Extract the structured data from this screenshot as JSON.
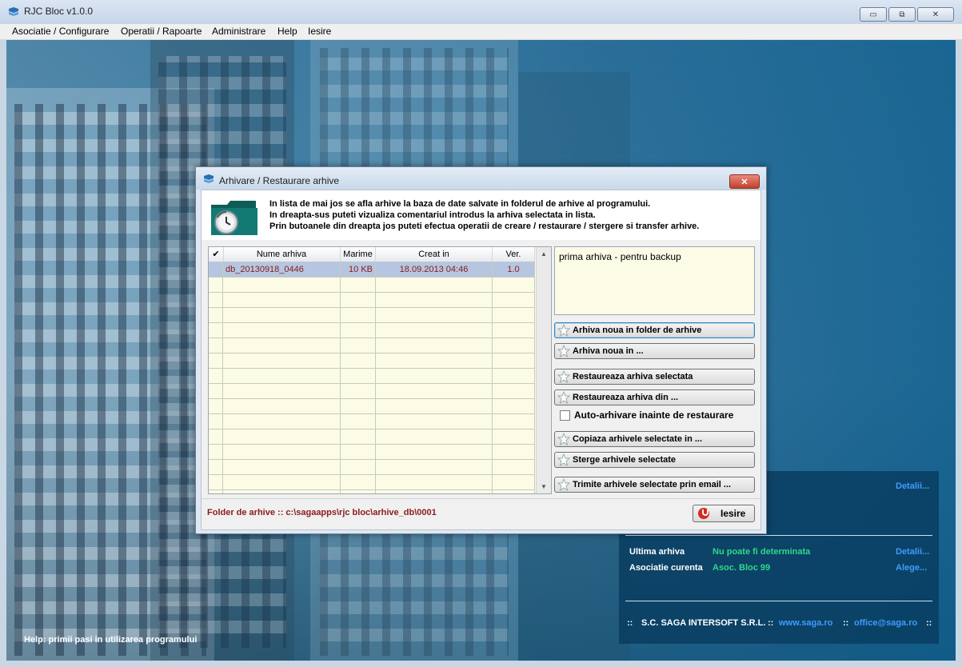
{
  "app": {
    "title": "RJC Bloc v1.0.0",
    "window_buttons": {
      "minimize": "▭",
      "restore": "⧉",
      "close": "✕"
    }
  },
  "menu": [
    {
      "label": "Asociatie / Configurare"
    },
    {
      "label": "Operatii / Rapoarte"
    },
    {
      "label": "Administrare"
    },
    {
      "label": "Help"
    },
    {
      "label": "Iesire"
    }
  ],
  "desktop": {
    "help_text": "Help: primii pasi in utilizarea programului"
  },
  "info_panel": {
    "top_link": "Detalii...",
    "last_archive_label": "Ultima arhiva",
    "last_archive_value": "Nu poate fi determinata",
    "last_archive_link": "Detalii...",
    "current_assoc_label": "Asociatie curenta",
    "current_assoc_value": "Asoc. Bloc 99",
    "current_assoc_link": "Alege...",
    "footer_sep1": "::",
    "company": "S.C. SAGA INTERSOFT S.R.L.",
    "footer_sep2": "::",
    "website": "www.saga.ro",
    "footer_sep3": "::",
    "email": "office@saga.ro",
    "footer_sep4": "::"
  },
  "dialog": {
    "title": "Arhivare / Restaurare arhive",
    "close_label": "✕",
    "intro_lines": [
      "In lista de mai jos se afla arhive la baza de date salvate in folderul de arhive al programului.",
      "In dreapta-sus puteti vizualiza comentariul introdus la arhiva selectata in lista.",
      "Prin butoanele din dreapta jos puteti efectua operatii de creare / restaurare / stergere si transfer arhive."
    ],
    "table": {
      "check_header": "✔",
      "columns": [
        "Nume arhiva",
        "Marime",
        "Creat in",
        "Ver."
      ],
      "rows": [
        {
          "name": "db_20130918_0446",
          "size": "10 KB",
          "created": "18.09.2013 04:46",
          "ver": "1.0"
        }
      ]
    },
    "comment": "prima arhiva - pentru backup",
    "buttons": {
      "new_archive_folder": "Arhiva noua in folder de arhive",
      "new_archive_in": "Arhiva noua in ...",
      "restore_selected": "Restaureaza arhiva selectata",
      "restore_from": "Restaureaza arhiva din ...",
      "copy_selected": "Copiaza arhivele selectate in ...",
      "delete_selected": "Sterge arhivele selectate",
      "email_selected": "Trimite arhivele selectate prin email ..."
    },
    "auto_archive_label": "Auto-arhivare inainte de restaurare",
    "auto_archive_checked": false,
    "folder_label": "Folder de arhive ::  c:\\sagaapps\\rjc bloc\\arhive_db\\0001",
    "exit_label": "Iesire"
  }
}
